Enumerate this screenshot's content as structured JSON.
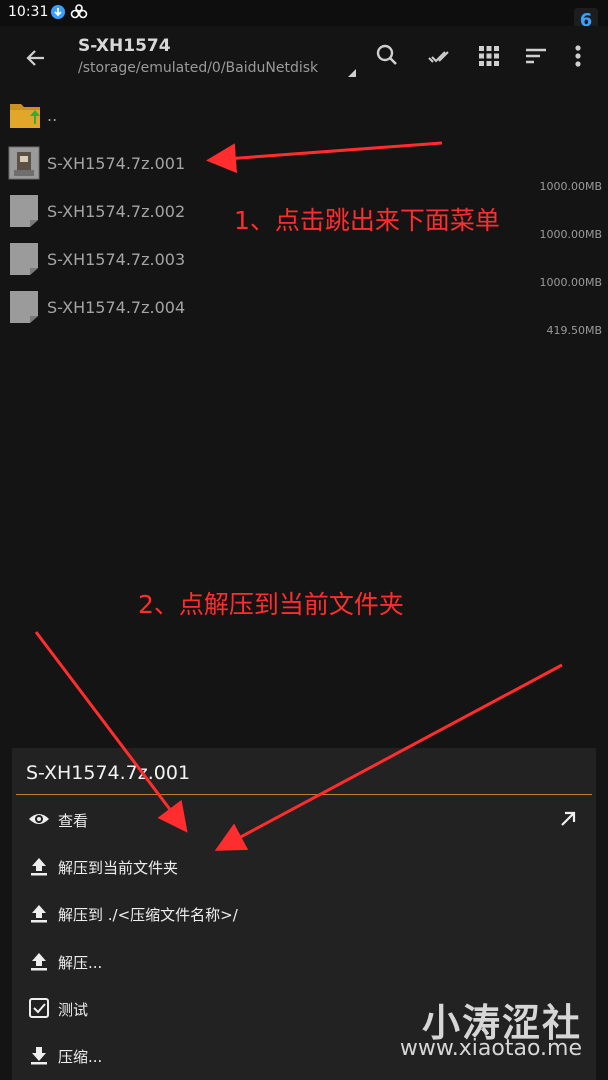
{
  "status_bar": {
    "time": "10:31",
    "badge": "6",
    "icons": [
      "download-icon",
      "link-icon"
    ]
  },
  "app_bar": {
    "title": "S-XH1574",
    "path": "/storage/emulated/0/BaiduNetdisk",
    "icons": [
      "back-arrow-icon",
      "search-icon",
      "select-all-icon",
      "grid-view-icon",
      "sort-icon",
      "more-vert-icon"
    ]
  },
  "files": [
    {
      "name": "..",
      "size": "",
      "icon": "parent-folder-icon"
    },
    {
      "name": "S-XH1574.7z.001",
      "size": "1000.00MB",
      "icon": "archive-icon"
    },
    {
      "name": "S-XH1574.7z.002",
      "size": "1000.00MB",
      "icon": "file-icon"
    },
    {
      "name": "S-XH1574.7z.003",
      "size": "1000.00MB",
      "icon": "file-icon"
    },
    {
      "name": "S-XH1574.7z.004",
      "size": "419.50MB",
      "icon": "file-icon"
    }
  ],
  "annotations": {
    "step1": "1、点击跳出来下面菜单",
    "step2": "2、点解压到当前文件夹"
  },
  "sheet": {
    "title": "S-XH1574.7z.001",
    "accent_color": "#c07a2a",
    "items": [
      {
        "label": "查看",
        "icon": "eye-icon",
        "action_icon": "open-external-icon"
      },
      {
        "label": "解压到当前文件夹",
        "icon": "upload-icon"
      },
      {
        "label": "解压到 ./<压缩文件名称>/",
        "icon": "upload-icon"
      },
      {
        "label": "解压...",
        "icon": "upload-icon"
      },
      {
        "label": "测试",
        "icon": "checkbox-icon"
      },
      {
        "label": "压缩...",
        "icon": "download-icon"
      }
    ]
  },
  "watermark": {
    "title": "小涛涩社",
    "url": "www.xiaotao.me"
  },
  "colors": {
    "background": "#141414",
    "annotation": "#ff2d2d",
    "badge": "#3aa0ff"
  }
}
